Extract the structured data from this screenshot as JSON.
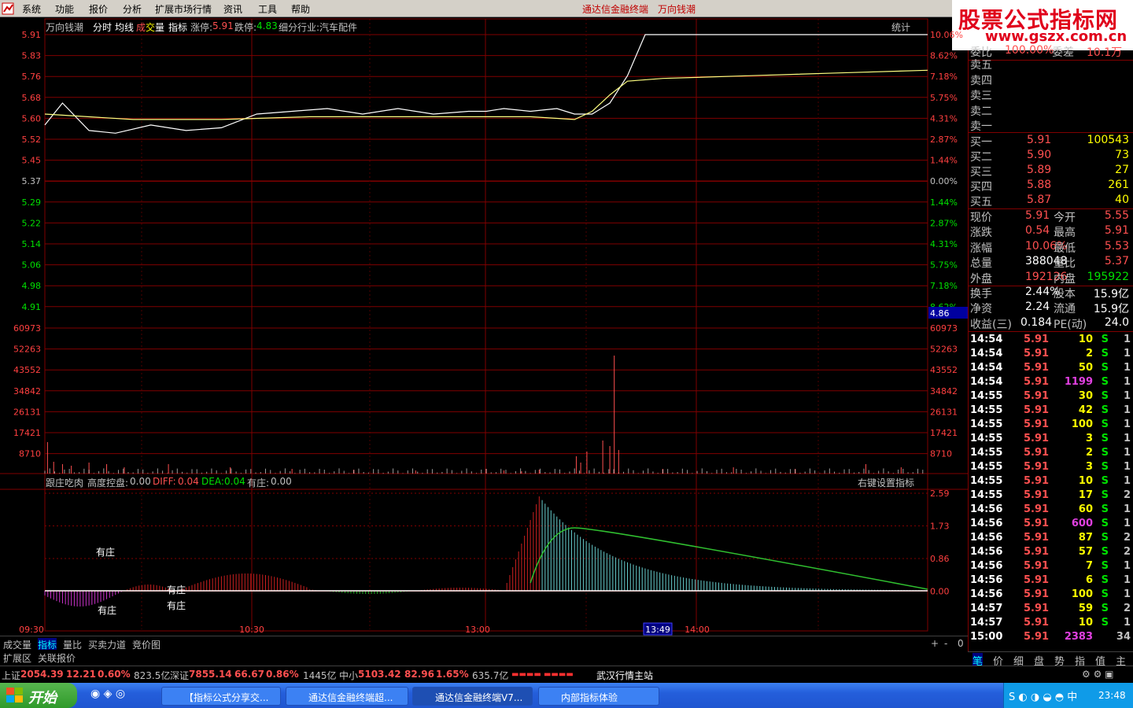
{
  "menu": {
    "items": [
      "系统",
      "功能",
      "报价",
      "分析",
      "扩展市场行情",
      "资讯",
      "工具",
      "帮助"
    ],
    "title_left": "通达信金融终端",
    "title_right": "万向钱潮"
  },
  "brand": {
    "line1": "股票公式指标网",
    "line2": "www.gszx.com.cn"
  },
  "chart_header": {
    "name": "万向钱潮",
    "fenshi": "分时",
    "junxian": "均线",
    "cheng": "成",
    "jiao": "交",
    "liang": "量",
    "zhibiao": "指标",
    "zt_label": "涨停:",
    "zt_val": "5.91",
    "dt_label": "跌停:",
    "dt_val": "4.83",
    "industry": "细分行业:汽车配件",
    "tongji": "统计"
  },
  "price_axis": {
    "left": [
      "5.91",
      "5.83",
      "5.76",
      "5.68",
      "5.60",
      "5.52",
      "5.45",
      "5.37",
      "5.29",
      "5.22",
      "5.14",
      "5.06",
      "4.98",
      "4.91"
    ],
    "right": [
      "10.06%",
      "8.62%",
      "7.18%",
      "5.75%",
      "4.31%",
      "2.87%",
      "1.44%",
      "0.00%",
      "1.44%",
      "2.87%",
      "4.31%",
      "5.75%",
      "7.18%",
      "8.62%"
    ],
    "cursor_label": "4.86"
  },
  "volume_axis": [
    "60973",
    "52263",
    "43552",
    "34842",
    "26131",
    "17421",
    "8710"
  ],
  "indicator_header": {
    "name": "跟庄吃肉",
    "h_label": "高度控盘:",
    "h_val": "0.00",
    "diff_label": "DIFF:",
    "diff_val": "0.04",
    "dea_label": "DEA:",
    "dea_val": "0.04",
    "yz_label": "有庄:",
    "yz_val": "0.00",
    "setting": "右键设置指标"
  },
  "indicator_axis": [
    "2.59",
    "1.73",
    "0.86",
    "0.00"
  ],
  "indicator_labels": [
    "有庄",
    "有庄",
    "有庄",
    "有庄"
  ],
  "time_axis": [
    "09:30",
    "10:30",
    "13:00",
    "13:49",
    "14:00"
  ],
  "chart_data": {
    "type": "line",
    "title": "万向钱潮",
    "ylim": [
      4.83,
      5.91
    ],
    "x_labels": [
      "09:30",
      "10:30",
      "13:00",
      "14:00"
    ],
    "series": [
      {
        "name": "price",
        "points": [
          [
            0,
            5.58
          ],
          [
            0.02,
            5.66
          ],
          [
            0.05,
            5.56
          ],
          [
            0.08,
            5.55
          ],
          [
            0.12,
            5.58
          ],
          [
            0.16,
            5.56
          ],
          [
            0.2,
            5.57
          ],
          [
            0.24,
            5.62
          ],
          [
            0.28,
            5.63
          ],
          [
            0.32,
            5.64
          ],
          [
            0.36,
            5.62
          ],
          [
            0.4,
            5.64
          ],
          [
            0.44,
            5.62
          ],
          [
            0.48,
            5.63
          ],
          [
            0.5,
            5.63
          ],
          [
            0.52,
            5.64
          ],
          [
            0.55,
            5.63
          ],
          [
            0.58,
            5.64
          ],
          [
            0.6,
            5.62
          ],
          [
            0.62,
            5.62
          ],
          [
            0.64,
            5.66
          ],
          [
            0.66,
            5.76
          ],
          [
            0.68,
            5.91
          ],
          [
            0.72,
            5.91
          ],
          [
            0.8,
            5.91
          ],
          [
            0.9,
            5.91
          ],
          [
            1,
            5.91
          ]
        ]
      },
      {
        "name": "avg",
        "points": [
          [
            0,
            5.62
          ],
          [
            0.1,
            5.6
          ],
          [
            0.2,
            5.6
          ],
          [
            0.3,
            5.61
          ],
          [
            0.4,
            5.61
          ],
          [
            0.5,
            5.61
          ],
          [
            0.55,
            5.61
          ],
          [
            0.6,
            5.6
          ],
          [
            0.62,
            5.63
          ],
          [
            0.64,
            5.69
          ],
          [
            0.66,
            5.74
          ],
          [
            0.7,
            5.75
          ],
          [
            0.8,
            5.76
          ],
          [
            0.9,
            5.77
          ],
          [
            1,
            5.78
          ]
        ]
      }
    ]
  },
  "tabs": {
    "t1": "成交量",
    "t2": "指标",
    "t3": "量比",
    "t4": "买卖力道",
    "t5": "竞价图",
    "t6": "扩展区",
    "t7": "关联报价"
  },
  "orderbook": {
    "top_row": [
      "委比",
      "100.00%",
      "委差",
      "10.1万"
    ],
    "sell": [
      "卖五",
      "卖四",
      "卖三",
      "卖二",
      "卖一"
    ],
    "buy": [
      {
        "label": "买一",
        "price": "5.91",
        "vol": "100543"
      },
      {
        "label": "买二",
        "price": "5.90",
        "vol": "73"
      },
      {
        "label": "买三",
        "price": "5.89",
        "vol": "27"
      },
      {
        "label": "买四",
        "price": "5.88",
        "vol": "261"
      },
      {
        "label": "买五",
        "price": "5.87",
        "vol": "40"
      }
    ]
  },
  "quote": [
    {
      "k1": "现价",
      "v1": "5.91",
      "k2": "今开",
      "v2": "5.55"
    },
    {
      "k1": "涨跌",
      "v1": "0.54",
      "k2": "最高",
      "v2": "5.91"
    },
    {
      "k1": "涨幅",
      "v1": "10.06%",
      "k2": "最低",
      "v2": "5.53"
    },
    {
      "k1": "总量",
      "v1": "388048",
      "k2": "量比",
      "v2": "5.37"
    },
    {
      "k1": "外盘",
      "v1": "192126",
      "k2": "内盘",
      "v2": "195922"
    },
    {
      "k1": "换手",
      "v1": "2.44%",
      "k2": "股本",
      "v2": "15.9亿"
    },
    {
      "k1": "净资",
      "v1": "2.24",
      "k2": "流通",
      "v2": "15.9亿"
    },
    {
      "k1": "收益(三)",
      "v1": "0.184",
      "k2": "PE(动)",
      "v2": "24.0"
    }
  ],
  "ticks": [
    {
      "t": "14:54",
      "p": "5.91",
      "v": "10",
      "s": "S",
      "n": "1"
    },
    {
      "t": "14:54",
      "p": "5.91",
      "v": "2",
      "s": "S",
      "n": "1"
    },
    {
      "t": "14:54",
      "p": "5.91",
      "v": "50",
      "s": "S",
      "n": "1"
    },
    {
      "t": "14:54",
      "p": "5.91",
      "v": "1199",
      "s": "S",
      "n": "1"
    },
    {
      "t": "14:55",
      "p": "5.91",
      "v": "30",
      "s": "S",
      "n": "1"
    },
    {
      "t": "14:55",
      "p": "5.91",
      "v": "42",
      "s": "S",
      "n": "1"
    },
    {
      "t": "14:55",
      "p": "5.91",
      "v": "100",
      "s": "S",
      "n": "1"
    },
    {
      "t": "14:55",
      "p": "5.91",
      "v": "3",
      "s": "S",
      "n": "1"
    },
    {
      "t": "14:55",
      "p": "5.91",
      "v": "2",
      "s": "S",
      "n": "1"
    },
    {
      "t": "14:55",
      "p": "5.91",
      "v": "3",
      "s": "S",
      "n": "1"
    },
    {
      "t": "14:55",
      "p": "5.91",
      "v": "10",
      "s": "S",
      "n": "1"
    },
    {
      "t": "14:55",
      "p": "5.91",
      "v": "17",
      "s": "S",
      "n": "2"
    },
    {
      "t": "14:56",
      "p": "5.91",
      "v": "60",
      "s": "S",
      "n": "1"
    },
    {
      "t": "14:56",
      "p": "5.91",
      "v": "600",
      "s": "S",
      "n": "1"
    },
    {
      "t": "14:56",
      "p": "5.91",
      "v": "87",
      "s": "S",
      "n": "2"
    },
    {
      "t": "14:56",
      "p": "5.91",
      "v": "57",
      "s": "S",
      "n": "2"
    },
    {
      "t": "14:56",
      "p": "5.91",
      "v": "7",
      "s": "S",
      "n": "1"
    },
    {
      "t": "14:56",
      "p": "5.91",
      "v": "6",
      "s": "S",
      "n": "1"
    },
    {
      "t": "14:56",
      "p": "5.91",
      "v": "100",
      "s": "S",
      "n": "1"
    },
    {
      "t": "14:57",
      "p": "5.91",
      "v": "59",
      "s": "S",
      "n": "2"
    },
    {
      "t": "14:57",
      "p": "5.91",
      "v": "10",
      "s": "S",
      "n": "1"
    },
    {
      "t": "15:00",
      "p": "5.91",
      "v": "2383",
      "s": "",
      "n": "34"
    }
  ],
  "right_tabs": [
    "笔",
    "价",
    "细",
    "盘",
    "势",
    "指",
    "值",
    "主"
  ],
  "status": {
    "sh_label": "上证",
    "sh_val": "2054.39",
    "sh_chg": "12.21",
    "sh_pct": "0.60%",
    "sh_amt": "823.5亿",
    "sz_label": "深证",
    "sz_val": "7855.14",
    "sz_chg": "66.67",
    "sz_pct": "0.86%",
    "sz_amt": "1445亿",
    "zx_label": "中小",
    "zx_val": "5103.42",
    "zx_chg": "82.96",
    "zx_pct": "1.65%",
    "zx_amt": "635.7亿",
    "station": "武汉行情主站"
  },
  "taskbar": {
    "start": "开始",
    "tasks": [
      "【指标公式分享交...",
      "通达信金融终端超...",
      "通达信金融终端V7...",
      "内部指标体验"
    ],
    "clock": "23:48"
  },
  "colors": {
    "red": "#ff5050",
    "green": "#00e000",
    "yellow": "#ffff00",
    "grid": "#800000",
    "axis_red": "#ff4040"
  }
}
